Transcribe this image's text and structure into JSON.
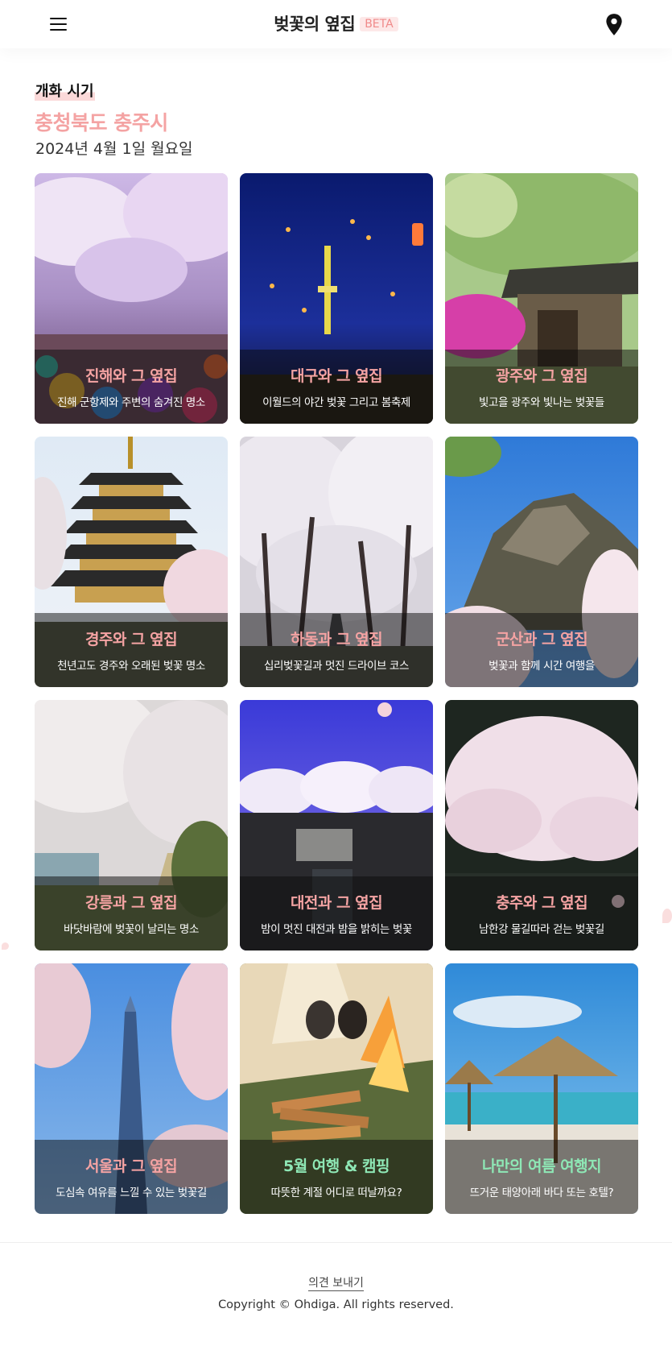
{
  "header": {
    "title": "벚꽃의 옆집",
    "badge": "BETA"
  },
  "intro": {
    "label": "개화 시기",
    "region": "충청북도 충주시",
    "date": "2024년 4월 1일 월요일"
  },
  "cards": [
    {
      "title": "진해와 그 옆집",
      "subtitle": "진해 군항제와 주변의 숨겨진 명소",
      "accent": "pink"
    },
    {
      "title": "대구와 그 옆집",
      "subtitle": "이월드의 야간 벚꽃 그리고 봄축제",
      "accent": "pink"
    },
    {
      "title": "광주와 그 옆집",
      "subtitle": "빛고을 광주와 빛나는 벚꽃들",
      "accent": "pink"
    },
    {
      "title": "경주와 그 옆집",
      "subtitle": "천년고도 경주와 오래된 벚꽃 명소",
      "accent": "pink"
    },
    {
      "title": "하동과 그 옆집",
      "subtitle": "십리벚꽃길과 멋진 드라이브 코스",
      "accent": "pink"
    },
    {
      "title": "군산과 그 옆집",
      "subtitle": "벚꽃과 함께 시간 여행을",
      "accent": "pink"
    },
    {
      "title": "강릉과 그 옆집",
      "subtitle": "바닷바람에 벚꽃이 날리는 명소",
      "accent": "pink"
    },
    {
      "title": "대전과 그 옆집",
      "subtitle": "밤이 멋진 대전과 밤을 밝히는 벚꽃",
      "accent": "pink"
    },
    {
      "title": "충주와 그 옆집",
      "subtitle": "남한강 물길따라 걷는 벚꽃길",
      "accent": "pink"
    },
    {
      "title": "서울과 그 옆집",
      "subtitle": "도심속 여유를 느낄 수 있는 벚꽃길",
      "accent": "pink"
    },
    {
      "title": "5월 여행 & 캠핑",
      "subtitle": "따뜻한 계절 어디로 떠날까요?",
      "accent": "green"
    },
    {
      "title": "나만의 여름 여행지",
      "subtitle": "뜨거운 태양아래 바다 또는 호텔?",
      "accent": "green"
    }
  ],
  "footer": {
    "feedback": "의견 보내기",
    "copyright": "Copyright © Ohdiga. All rights reserved."
  },
  "icons": {
    "menu": "menu-icon",
    "location": "map-pin-icon"
  },
  "colors": {
    "accent_pink": "#f5a3a3",
    "accent_green": "#8ee7b5",
    "badge_bg": "#fde8e8"
  }
}
